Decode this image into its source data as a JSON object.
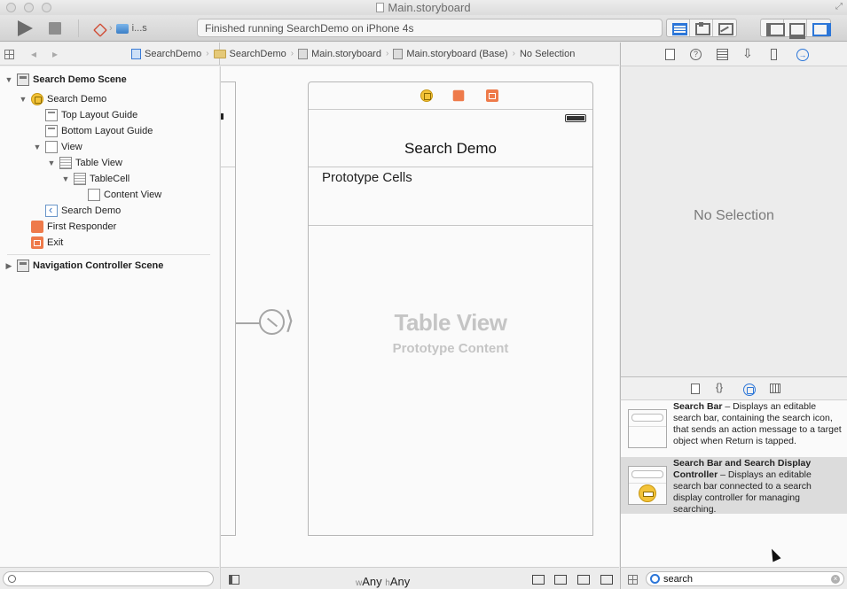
{
  "window": {
    "title": "Main.storyboard"
  },
  "toolbar": {
    "scheme_device": "i...s",
    "activity_status": "Finished running SearchDemo on iPhone 4s"
  },
  "jumpbar": {
    "crumbs": [
      "SearchDemo",
      "SearchDemo",
      "Main.storyboard",
      "Main.storyboard (Base)",
      "No Selection"
    ]
  },
  "outline": {
    "items": [
      {
        "label": "Search Demo Scene",
        "icon": "scene-icon"
      },
      {
        "label": "Search Demo",
        "icon": "view-controller-icon"
      },
      {
        "label": "Top Layout Guide",
        "icon": "layout-guide-icon"
      },
      {
        "label": "Bottom Layout Guide",
        "icon": "layout-guide-icon"
      },
      {
        "label": "View",
        "icon": "view-icon"
      },
      {
        "label": "Table View",
        "icon": "table-view-icon"
      },
      {
        "label": "TableCell",
        "icon": "table-cell-icon"
      },
      {
        "label": "Content View",
        "icon": "view-icon"
      },
      {
        "label": "Search Demo",
        "icon": "navigation-item-icon"
      },
      {
        "label": "First Responder",
        "icon": "first-responder-icon"
      },
      {
        "label": "Exit",
        "icon": "exit-icon"
      },
      {
        "label": "Navigation Controller Scene",
        "icon": "scene-icon"
      }
    ]
  },
  "canvas": {
    "nav_title": "Search Demo",
    "prototype_cells": "Prototype Cells",
    "placeholder_title": "Table View",
    "placeholder_subtitle": "Prototype Content",
    "size_class": {
      "w_prefix": "w",
      "w_value": "Any",
      "h_prefix": "h",
      "h_value": "Any"
    }
  },
  "inspector": {
    "empty_label": "No Selection"
  },
  "library": {
    "items": [
      {
        "title": "Search Bar",
        "description": " – Displays an editable search bar, containing the search icon, that sends an action message to a target object when Return is tapped."
      },
      {
        "title": "Search Bar and Search Display Controller",
        "description": " – Displays an editable search bar connected to a search display controller for managing searching."
      }
    ],
    "search": {
      "value": "search"
    }
  },
  "colors": {
    "accent": "#2c76d8",
    "object_icon": "#ee7a4a",
    "vc_icon": "#f3c338"
  }
}
